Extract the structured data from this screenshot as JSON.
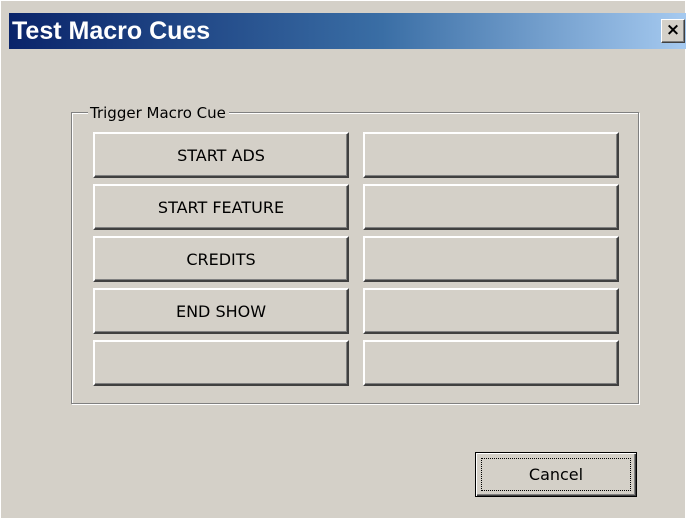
{
  "window": {
    "title": "Test Macro Cues",
    "close_glyph": "×",
    "close_icon": "close-icon"
  },
  "group": {
    "label": "Trigger Macro Cue",
    "buttons": [
      {
        "label": "START ADS"
      },
      {
        "label": ""
      },
      {
        "label": "START FEATURE"
      },
      {
        "label": ""
      },
      {
        "label": "CREDITS"
      },
      {
        "label": ""
      },
      {
        "label": "END SHOW"
      },
      {
        "label": ""
      },
      {
        "label": ""
      },
      {
        "label": ""
      }
    ]
  },
  "footer": {
    "cancel_label": "Cancel"
  },
  "colors": {
    "title_gradient_start": "#0a246a",
    "title_gradient_end": "#a6caf0",
    "face": "#d4d0c8"
  }
}
